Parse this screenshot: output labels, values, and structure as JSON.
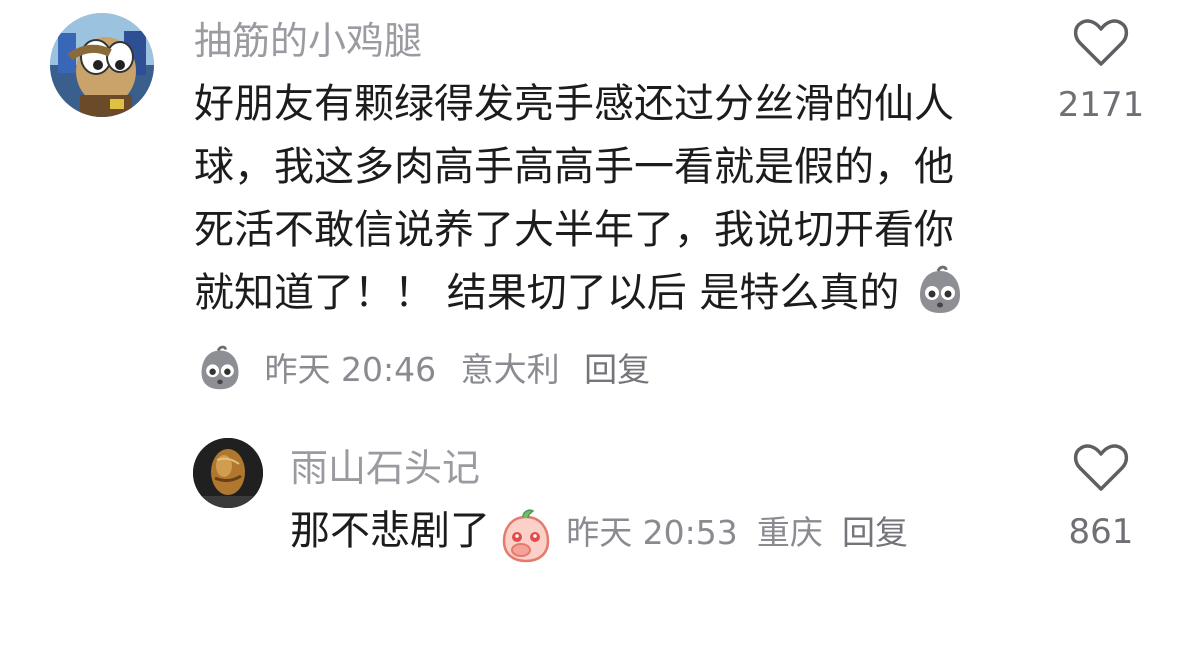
{
  "comment": {
    "username": "抽筋的小鸡腿",
    "lines": [
      "好朋友有颗绿得发亮手感还过分丝滑的仙人",
      "球，我这多肉高手高高手一看就是假的，他",
      "死活不敢信说养了大半年了，我说切开看你",
      "就知道了！！ 结果切了以后 是特么真的"
    ],
    "time": "昨天 20:46",
    "location": "意大利",
    "reply_label": "回复",
    "likes": "2171"
  },
  "reply": {
    "username": "雨山石头记",
    "text": "那不悲剧了",
    "time": "昨天 20:53",
    "location": "重庆",
    "reply_label": "回复",
    "likes": "861"
  },
  "icons": {
    "like": "heart-outline-icon",
    "sticker_1": "worried-face-sticker",
    "sticker_2": "shy-face-sticker"
  },
  "colors": {
    "username": "#9a9ba0",
    "body": "#1c1c1e",
    "meta": "#8a8b91"
  }
}
